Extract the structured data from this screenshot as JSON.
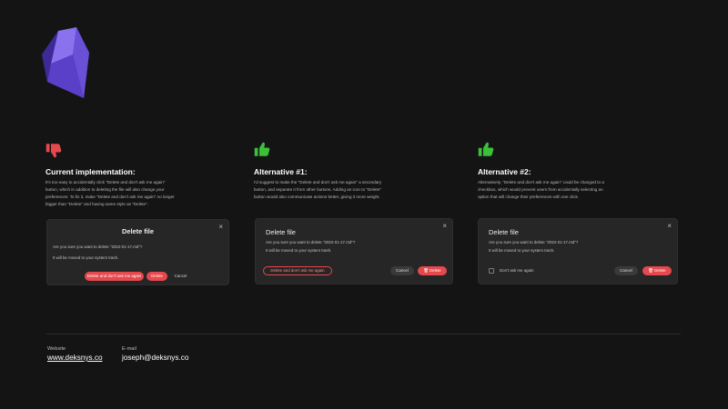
{
  "icons": {
    "logo": "obsidian-crystal-logo",
    "thumbs_down": "thumbs-down-icon",
    "thumbs_up": "thumbs-up-icon"
  },
  "colors": {
    "background": "#141414",
    "dialog": "#262626",
    "danger": "#e5484d",
    "positive": "#3dbf3a",
    "logo": "#6b4fd8"
  },
  "columns": [
    {
      "title": "Current implementation:",
      "desc_lines": [
        "It's too easy to accidentally click \"Delete and don't ask me again\"",
        "button, which in addition to deleting the file will also change your",
        "preferences. To fix it, make \"Delete and don't ask me again\" no longer",
        "bigger than \"Delete\" and having same style as \"Delete\"."
      ]
    },
    {
      "title": "Alternative #1:",
      "desc_lines": [
        "I'd suggest to make the \"Delete and don't ask me again\" a secondary",
        "button, and separate it from other buttons. Adding an icon to \"Delete\"",
        "button would also communicate actions better, giving it more weight."
      ]
    },
    {
      "title": "Alternative #2:",
      "desc_lines": [
        "Alternatively, \"Delete and don't ask me again\" could be changed to a",
        "checkbox, which would prevent users from accidentally selecting an",
        "option that will change their preferences with one click."
      ]
    }
  ],
  "dialogs": {
    "title": "Delete file",
    "question": "Are you sure you want to delete \"2022-01-17.md\"?",
    "note": "It will be moved to your system trash.",
    "delete_dont_ask": "Delete and don't ask me again",
    "delete": "Delete",
    "cancel": "Cancel",
    "dont_ask": "Don't ask me again",
    "close": "×"
  },
  "footer": {
    "website_label": "Website",
    "website": "www.deksnys.co",
    "email_label": "E-mail",
    "email": "joseph@deksnys.co"
  }
}
